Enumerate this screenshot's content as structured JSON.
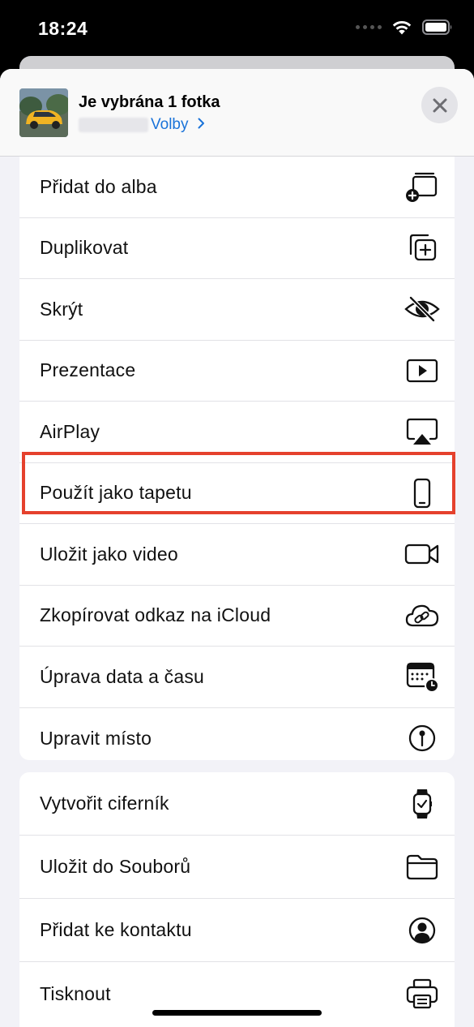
{
  "status_bar": {
    "time": "18:24",
    "icons": [
      "signal-dots-icon",
      "wifi-icon",
      "battery-icon"
    ]
  },
  "header": {
    "title": "Je vybrána 1 fotka",
    "options_label": "Volby",
    "thumbnail": "car-photo-thumbnail",
    "close_icon": "close-icon"
  },
  "actions_group_1": [
    {
      "label": "Přidat do alba",
      "icon": "add-to-album-icon"
    },
    {
      "label": "Duplikovat",
      "icon": "duplicate-icon"
    },
    {
      "label": "Skrýt",
      "icon": "eye-slash-icon"
    },
    {
      "label": "Prezentace",
      "icon": "play-rectangle-icon"
    },
    {
      "label": "AirPlay",
      "icon": "airplay-icon"
    },
    {
      "label": "Použít jako tapetu",
      "icon": "iphone-icon",
      "highlighted": true
    },
    {
      "label": "Uložit jako video",
      "icon": "video-camera-icon"
    },
    {
      "label": "Zkopírovat odkaz na iCloud",
      "icon": "cloud-link-icon"
    },
    {
      "label": "Úprava data a času",
      "icon": "calendar-clock-icon"
    },
    {
      "label": "Upravit místo",
      "icon": "location-pin-icon"
    }
  ],
  "actions_group_2": [
    {
      "label": "Vytvořit ciferník",
      "icon": "watch-icon"
    },
    {
      "label": "Uložit do Souborů",
      "icon": "folder-icon"
    },
    {
      "label": "Přidat ke kontaktu",
      "icon": "person-circle-icon"
    },
    {
      "label": "Tisknout",
      "icon": "printer-icon"
    }
  ],
  "colors": {
    "accent": "#1a73d9",
    "highlight": "#e5412d",
    "sheet_background": "#f2f2f7"
  }
}
